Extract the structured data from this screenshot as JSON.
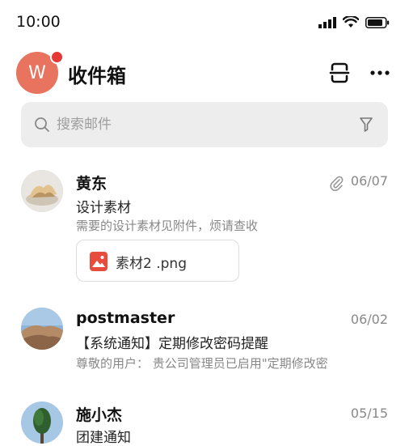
{
  "status_bar": {
    "time": "10:00"
  },
  "header": {
    "avatar_letter": "W",
    "title": "收件箱"
  },
  "search": {
    "placeholder": "搜索邮件"
  },
  "mails": [
    {
      "sender": "黄东",
      "date": "06/07",
      "subject": "设计素材",
      "preview": "需要的设计素材见附件，烦请查收",
      "has_attachment": true,
      "attachment_name": "素材2 .png"
    },
    {
      "sender": "postmaster",
      "date": "06/02",
      "subject": "【系统通知】定期修改密码提醒",
      "preview": "尊敬的用户： 贵公司管理员已启用\"定期修改密"
    },
    {
      "sender": "施小杰",
      "date": "05/15",
      "subject": "团建通知"
    }
  ],
  "colors": {
    "avatar_bg": "#e8735e",
    "unread_dot": "#e53935",
    "file_icon": "#e84c3d"
  }
}
